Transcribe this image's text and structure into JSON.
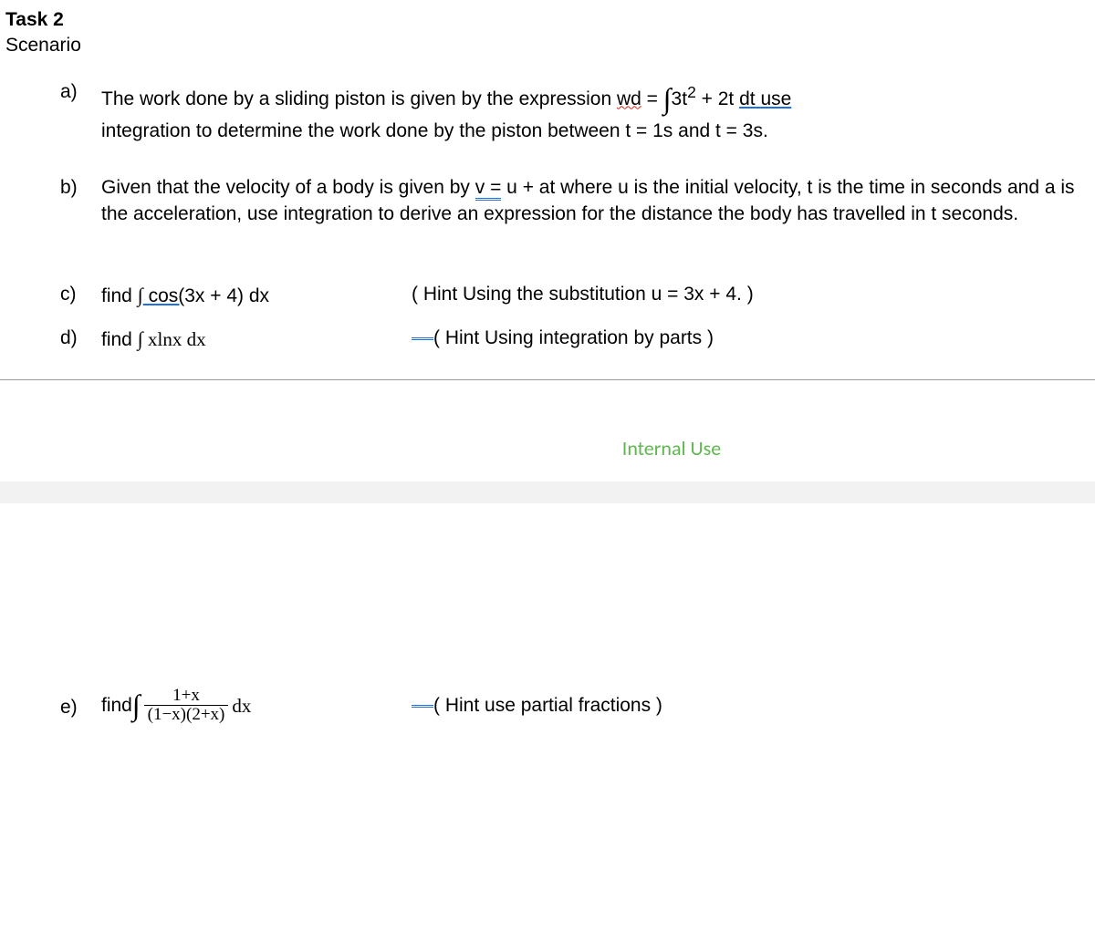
{
  "header": {
    "title": "Task 2",
    "subtitle": "Scenario"
  },
  "items": {
    "a": {
      "label": "a)",
      "t1": "The work done by a sliding piston is given by the expression ",
      "wd": "wd",
      "eq": " = ",
      "int": "∫",
      "term": "3t",
      "sup": "2",
      "plus": " + 2t ",
      "dt": "dt ",
      "use": " use",
      "line2": "integration to determine the work done by the piston between t = 1s and  t = 3s."
    },
    "b": {
      "label": "b)",
      "t1": "Given that the velocity of a body is given by   ",
      "vexp": "v =",
      "t2": "  u + at where u is the initial velocity, t is the time in seconds and a is the acceleration, use integration to derive an expression for the distance the body has travelled in t seconds."
    },
    "c": {
      "label": "c)",
      "find": "find ",
      "int": "∫",
      "cos": " cos(",
      "arg": "3x + 4) dx",
      "hint": "( Hint Using the substitution u = 3x + 4. )"
    },
    "d": {
      "label": "d)",
      "find": "find ",
      "int": "∫",
      "expr": " xlnx dx",
      "hint_open": "(",
      "hint_rest": " Hint Using integration by parts )"
    },
    "e": {
      "label": "e)",
      "find": "find ",
      "int": "∫",
      "num": "1+x",
      "den": "(1−x)(2+x)",
      "dx": " dx",
      "hint_open": "(",
      "hint_rest": " Hint use partial fractions )"
    }
  },
  "internal": "Internal Use"
}
